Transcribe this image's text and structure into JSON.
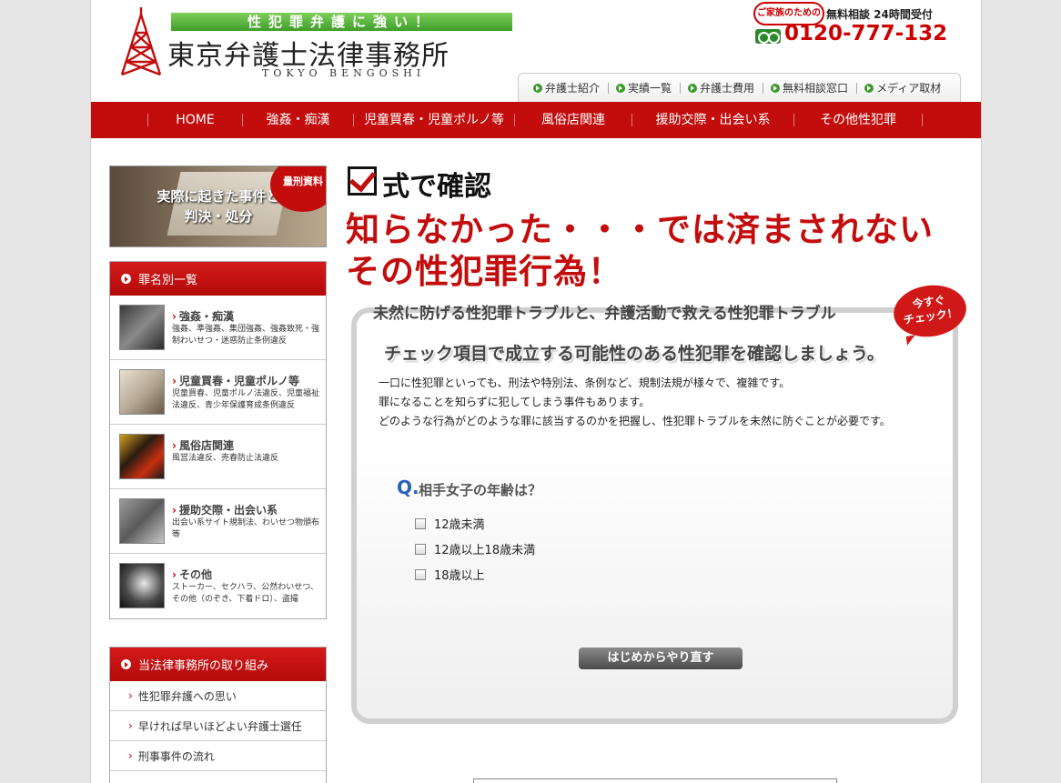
{
  "header": {
    "tagline": "性犯罪弁護に強い！",
    "firm_name": "東京弁護士法律事務所",
    "firm_name_en": "TOKYO BENGOSHI",
    "family_badge": "ご家族のための",
    "free_consult": "無料相談 24時間受付",
    "phone": "0120-777-132"
  },
  "subnav": [
    "弁護士紹介",
    "実績一覧",
    "弁護士費用",
    "無料相談窓口",
    "メディア取材"
  ],
  "mainnav": [
    "HOME",
    "強姦・痴漢",
    "児童買春・児童ポルノ等",
    "風俗店関連",
    "援助交際・出会い系",
    "その他性犯罪"
  ],
  "sidebar": {
    "banner_text_1": "実際に起きた事件と",
    "banner_text_2": "判決・処分",
    "banner_badge": "量刑資料",
    "crimes_title": "罪名別一覧",
    "crimes": [
      {
        "title": "強姦・痴漢",
        "desc": "強姦、準強姦、集団強姦、強姦致死・強制わいせつ・迷惑防止条例違反"
      },
      {
        "title": "児童買春・児童ポルノ等",
        "desc": "児童買春、児童ポルノ法違反、児童福祉法違反、青少年保護育成条例違反"
      },
      {
        "title": "風俗店関連",
        "desc": "風営法違反、売春防止法違反"
      },
      {
        "title": "援助交際・出会い系",
        "desc": "出会い系サイト規制法、わいせつ物頒布等"
      },
      {
        "title": "その他",
        "desc": "ストーカー、セクハラ、公然わいせつ、その他（のぞき、下着ドロ）、盗撮"
      }
    ],
    "efforts_title": "当法律事務所の取り組み",
    "efforts": [
      "性犯罪弁護への思い",
      "早ければ早いほどよい弁護士選任",
      "刑事事件の流れ"
    ]
  },
  "main": {
    "sub_heading": "式で確認",
    "headline_1": "知らなかった・・・では済まされない",
    "headline_2": "その性犯罪行為！",
    "lead": "未然に防げる性犯罪トラブルと、弁護活動で救える性犯罪トラブル",
    "check_badge_1": "今すぐ",
    "check_badge_2": "チェック！",
    "panel_title": "チェック項目で成立する可能性のある性犯罪を確認しましょう。",
    "panel_lines": [
      "一口に性犯罪といっても、刑法や特別法、条例など、規制法規が様々で、複雑です。",
      "罪になることを知らずに犯してしまう事件もあります。",
      "どのような行為がどのような罪に該当するのかを把握し、性犯罪トラブルを未然に防ぐことが必要です。"
    ],
    "q_mark": "Q.",
    "question": "相手女子の年齢は？",
    "options": [
      "12歳未満",
      "12歳以上18歳未満",
      "18歳以上"
    ],
    "restart_label": "はじめからやり直す"
  }
}
